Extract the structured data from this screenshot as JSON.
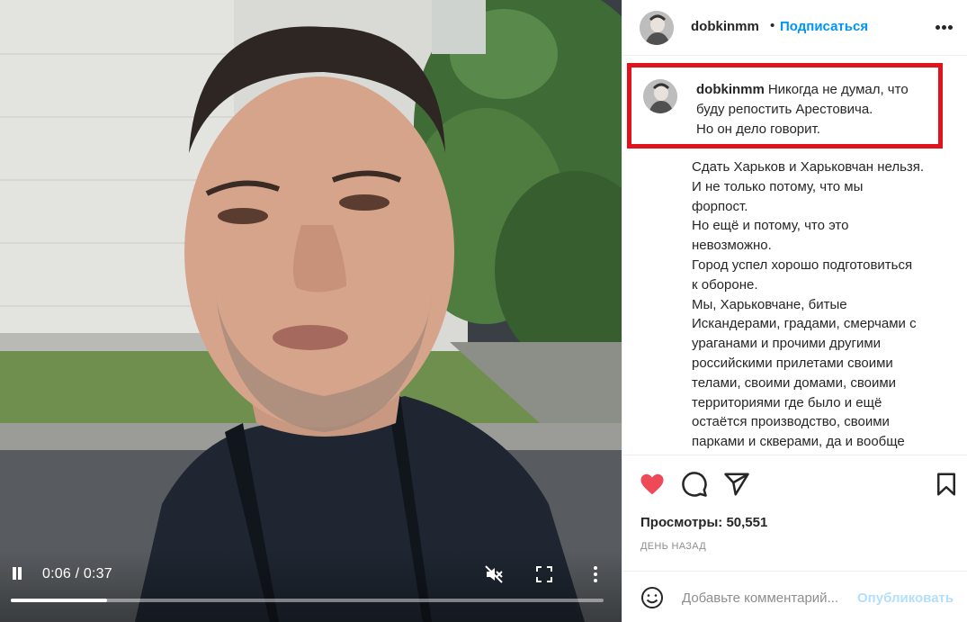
{
  "video": {
    "time_label": "0:06 / 0:37",
    "progress_fraction": 0.1622
  },
  "post": {
    "username": "dobkinmm",
    "separator": "•",
    "follow_label": "Подписаться",
    "caption_lines": [
      "Никогда не думал, что",
      "буду репостить Арестовича.",
      "Но он дело говорит."
    ],
    "body_lines": [
      "Сдать Харьков и Харьковчан нельзя.",
      "И не только потому, что мы",
      "форпост.",
      "Но ещё и потому, что это",
      "невозможно.",
      "Город успел хорошо подготовиться",
      "к обороне.",
      "Мы, Харьковчане, битые",
      "Искандерами, градами, смерчами с",
      "ураганами и прочими другими",
      "российскими прилетами своими",
      "телами, своими домами, своими",
      "территориями где было и ещё",
      "остаётся производство, своими",
      "парками и скверами, да и вообще"
    ],
    "views_label": "Просмотры:",
    "views_count": "50,551",
    "time_ago": "ДЕНЬ НАЗАД",
    "liked": true,
    "like_color": "#ed4956"
  },
  "comment": {
    "placeholder": "Добавьте комментарий...",
    "publish_label": "Опубликовать"
  },
  "icons": {
    "like": "heart-icon",
    "comment": "comment-icon",
    "share": "paper-plane-icon",
    "save": "bookmark-icon",
    "emoji": "smiley-icon",
    "play": "pause-icon",
    "mute": "muted-speaker-icon",
    "fullscreen": "fullscreen-icon",
    "more": "vertical-dots-icon"
  }
}
